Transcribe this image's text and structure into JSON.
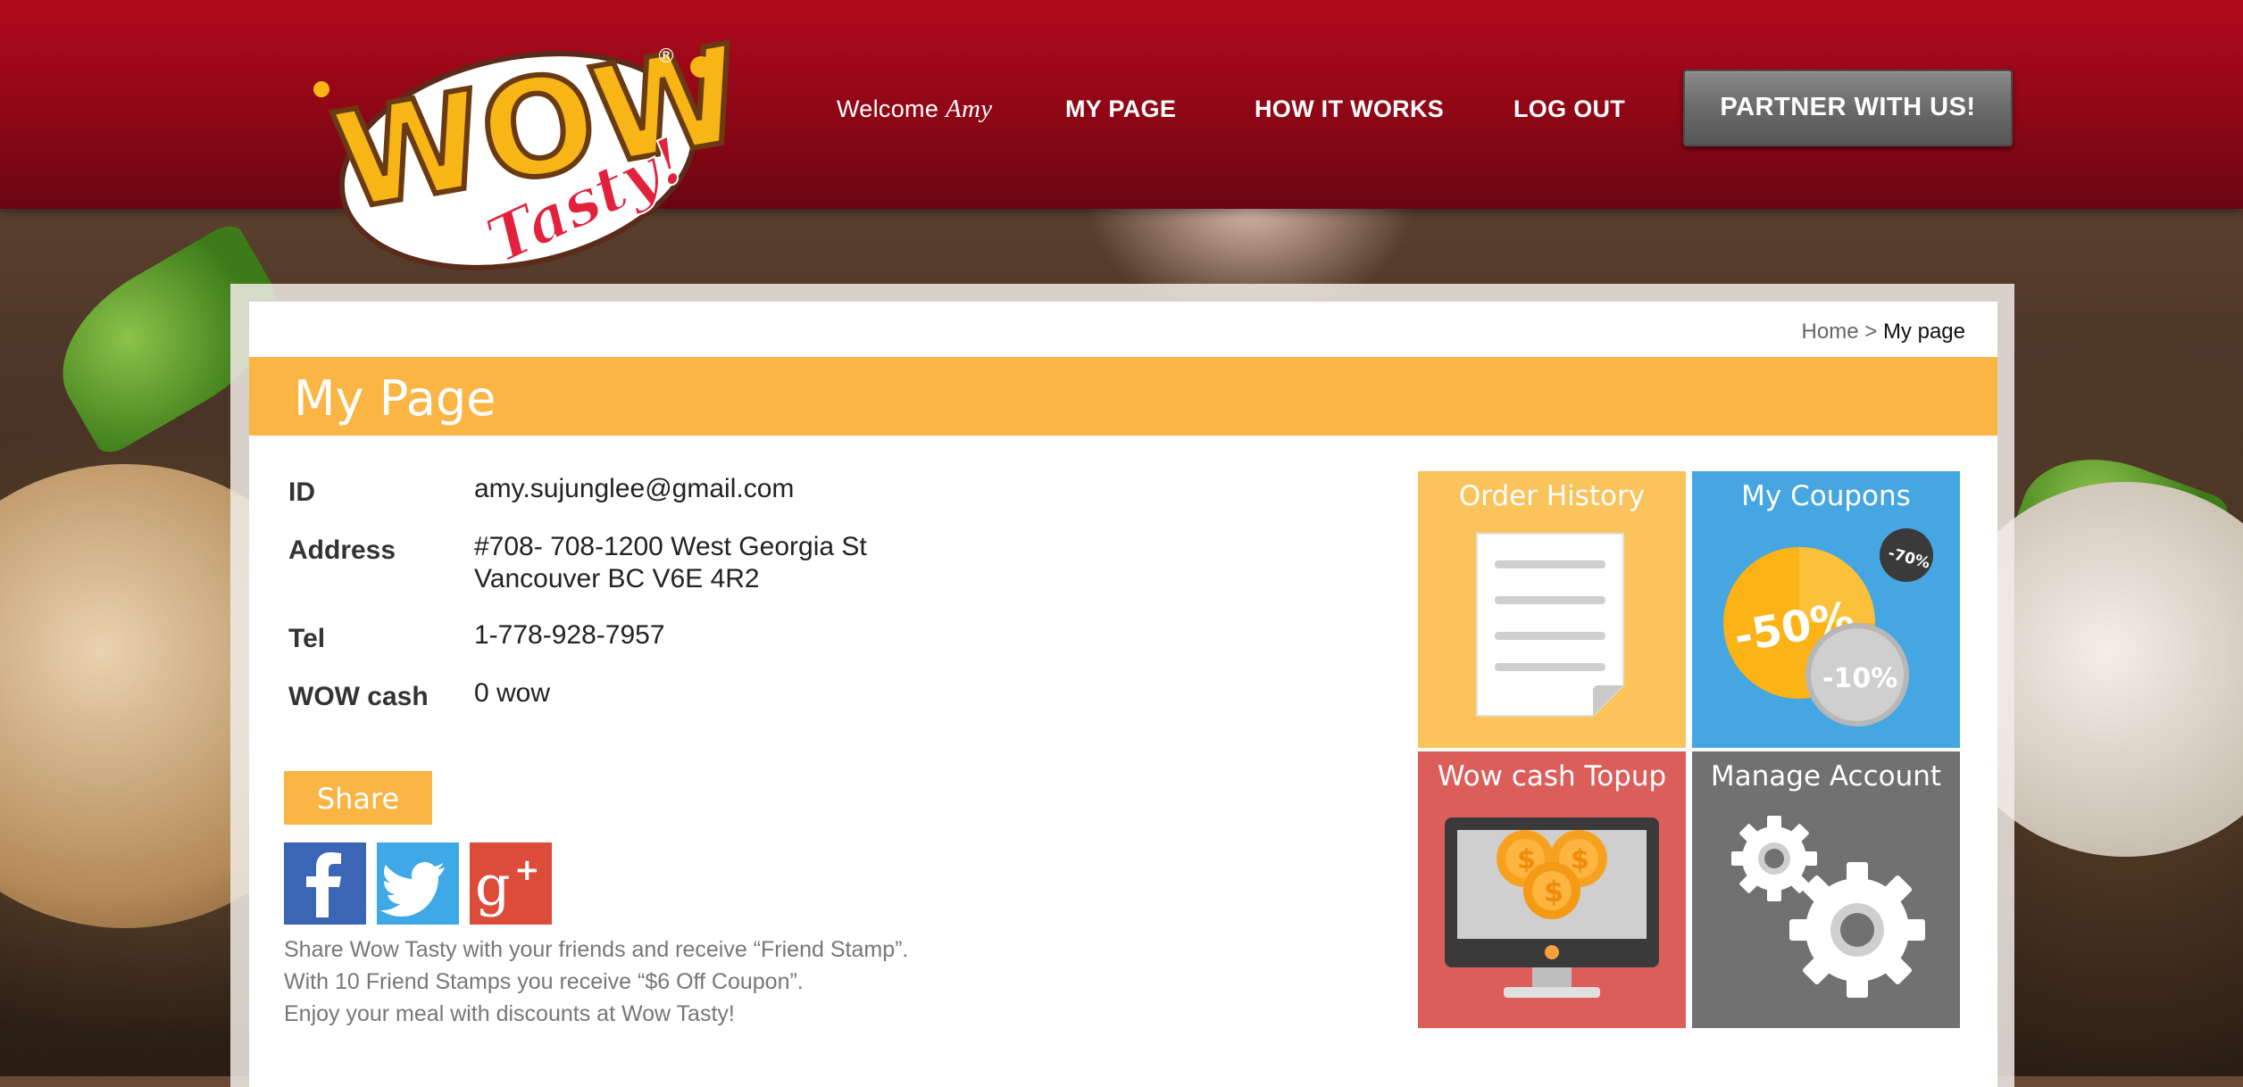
{
  "header": {
    "welcome_prefix": "Welcome",
    "user_name": "Amy",
    "nav": {
      "my_page": "MY PAGE",
      "how_it_works": "HOW IT WORKS",
      "log_out": "LOG OUT"
    },
    "partner_button": "PARTNER WITH US!",
    "logo": {
      "top_text": "WOW",
      "script_text": "Tasty!",
      "mark": "®"
    }
  },
  "breadcrumb": {
    "home": "Home",
    "separator": ">",
    "current": "My page"
  },
  "page_title": "My Page",
  "profile": {
    "id_label": "ID",
    "id_value": "amy.sujunglee@gmail.com",
    "address_label": "Address",
    "address_line1": "#708- 708-1200 West Georgia St",
    "address_line2": "Vancouver BC V6E 4R2",
    "tel_label": "Tel",
    "tel_value": "1-778-928-7957",
    "cash_label": "WOW cash",
    "cash_value": "0 wow"
  },
  "share": {
    "button_label": "Share",
    "social_icons": [
      "facebook-icon",
      "twitter-icon",
      "google-plus-icon"
    ],
    "line1": "Share Wow Tasty with your friends and receive “Friend Stamp”.",
    "line2": "With 10 Friend Stamps you receive “$6 Off Coupon”.",
    "line3": "Enjoy your meal with discounts at Wow Tasty!"
  },
  "tiles": {
    "order_history": "Order History",
    "my_coupons": "My Coupons",
    "coupon_badges": {
      "large": "-50%",
      "small": "-10%",
      "tiny": "-70%"
    },
    "wow_cash_topup": "Wow cash Topup",
    "manage_account": "Manage Account"
  },
  "colors": {
    "header_red": "#9c0818",
    "accent_orange": "#fbb545",
    "tile_yellow": "#fbc35b",
    "tile_blue": "#46a6e2",
    "tile_red": "#dc5e5a",
    "tile_gray": "#717171",
    "facebook": "#3b65b5",
    "twitter": "#3fa9e8",
    "google_plus": "#dd4b39"
  }
}
